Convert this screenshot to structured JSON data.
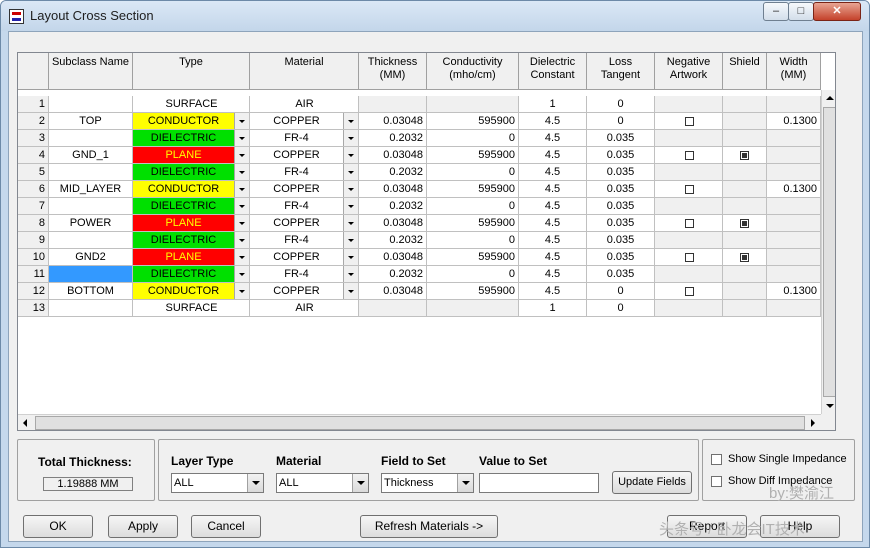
{
  "window": {
    "title": "Layout Cross Section"
  },
  "columns": [
    {
      "key": "num",
      "label": ""
    },
    {
      "key": "subclass",
      "label": "Subclass Name"
    },
    {
      "key": "type",
      "label": "Type"
    },
    {
      "key": "material",
      "label": "Material"
    },
    {
      "key": "thickness",
      "label": "Thickness\n(MM)"
    },
    {
      "key": "conductivity",
      "label": "Conductivity\n(mho/cm)"
    },
    {
      "key": "dielectric",
      "label": "Dielectric\nConstant"
    },
    {
      "key": "loss",
      "label": "Loss\nTangent"
    },
    {
      "key": "negative",
      "label": "Negative\nArtwork"
    },
    {
      "key": "shield",
      "label": "Shield"
    },
    {
      "key": "width",
      "label": "Width\n(MM)"
    }
  ],
  "type_colors": {
    "CONDUCTOR": "#ffff00",
    "DIELECTRIC": "#00e000",
    "PLANE": "#ff0000",
    "SURFACE": "#ffffff"
  },
  "rows": [
    {
      "num": "1",
      "subclass": "",
      "type": "SURFACE",
      "material": "AIR",
      "thickness": "",
      "conductivity": "",
      "dielectric": "1",
      "loss": "0",
      "negative": null,
      "shield": null,
      "width": ""
    },
    {
      "num": "2",
      "subclass": "TOP",
      "type": "CONDUCTOR",
      "material": "COPPER",
      "thickness": "0.03048",
      "conductivity": "595900",
      "dielectric": "4.5",
      "loss": "0",
      "negative": false,
      "shield": null,
      "width": "0.1300"
    },
    {
      "num": "3",
      "subclass": "",
      "type": "DIELECTRIC",
      "material": "FR-4",
      "thickness": "0.2032",
      "conductivity": "0",
      "dielectric": "4.5",
      "loss": "0.035",
      "negative": null,
      "shield": null,
      "width": ""
    },
    {
      "num": "4",
      "subclass": "GND_1",
      "type": "PLANE",
      "material": "COPPER",
      "thickness": "0.03048",
      "conductivity": "595900",
      "dielectric": "4.5",
      "loss": "0.035",
      "negative": false,
      "shield": true,
      "width": ""
    },
    {
      "num": "5",
      "subclass": "",
      "type": "DIELECTRIC",
      "material": "FR-4",
      "thickness": "0.2032",
      "conductivity": "0",
      "dielectric": "4.5",
      "loss": "0.035",
      "negative": null,
      "shield": null,
      "width": ""
    },
    {
      "num": "6",
      "subclass": "MID_LAYER",
      "type": "CONDUCTOR",
      "material": "COPPER",
      "thickness": "0.03048",
      "conductivity": "595900",
      "dielectric": "4.5",
      "loss": "0.035",
      "negative": false,
      "shield": null,
      "width": "0.1300"
    },
    {
      "num": "7",
      "subclass": "",
      "type": "DIELECTRIC",
      "material": "FR-4",
      "thickness": "0.2032",
      "conductivity": "0",
      "dielectric": "4.5",
      "loss": "0.035",
      "negative": null,
      "shield": null,
      "width": ""
    },
    {
      "num": "8",
      "subclass": "POWER",
      "type": "PLANE",
      "material": "COPPER",
      "thickness": "0.03048",
      "conductivity": "595900",
      "dielectric": "4.5",
      "loss": "0.035",
      "negative": false,
      "shield": true,
      "width": ""
    },
    {
      "num": "9",
      "subclass": "",
      "type": "DIELECTRIC",
      "material": "FR-4",
      "thickness": "0.2032",
      "conductivity": "0",
      "dielectric": "4.5",
      "loss": "0.035",
      "negative": null,
      "shield": null,
      "width": ""
    },
    {
      "num": "10",
      "subclass": "GND2",
      "type": "PLANE",
      "material": "COPPER",
      "thickness": "0.03048",
      "conductivity": "595900",
      "dielectric": "4.5",
      "loss": "0.035",
      "negative": false,
      "shield": true,
      "width": ""
    },
    {
      "num": "11",
      "subclass": "",
      "type": "DIELECTRIC",
      "material": "FR-4",
      "thickness": "0.2032",
      "conductivity": "0",
      "dielectric": "4.5",
      "loss": "0.035",
      "negative": null,
      "shield": null,
      "width": "",
      "selected": true
    },
    {
      "num": "12",
      "subclass": "BOTTOM",
      "type": "CONDUCTOR",
      "material": "COPPER",
      "thickness": "0.03048",
      "conductivity": "595900",
      "dielectric": "4.5",
      "loss": "0",
      "negative": false,
      "shield": null,
      "width": "0.1300"
    },
    {
      "num": "13",
      "subclass": "",
      "type": "SURFACE",
      "material": "AIR",
      "thickness": "",
      "conductivity": "",
      "dielectric": "1",
      "loss": "0",
      "negative": null,
      "shield": null,
      "width": ""
    }
  ],
  "total": {
    "label": "Total Thickness:",
    "value": "1.19888 MM"
  },
  "fields": {
    "layer_type": {
      "label": "Layer Type",
      "value": "ALL"
    },
    "material": {
      "label": "Material",
      "value": "ALL"
    },
    "field_to_set": {
      "label": "Field to Set",
      "value": "Thickness"
    },
    "value_to_set": {
      "label": "Value to Set",
      "value": ""
    },
    "update_label": "Update Fields"
  },
  "options": {
    "single": "Show Single Impedance",
    "diff": "Show Diff Impedance"
  },
  "buttons": {
    "ok": "OK",
    "apply": "Apply",
    "cancel": "Cancel",
    "refresh": "Refresh Materials ->",
    "report": "Report",
    "help": "Help"
  },
  "watermark": {
    "line1": "by:樊渝江",
    "line2": "头条号 / 卧龙会IT技术"
  }
}
